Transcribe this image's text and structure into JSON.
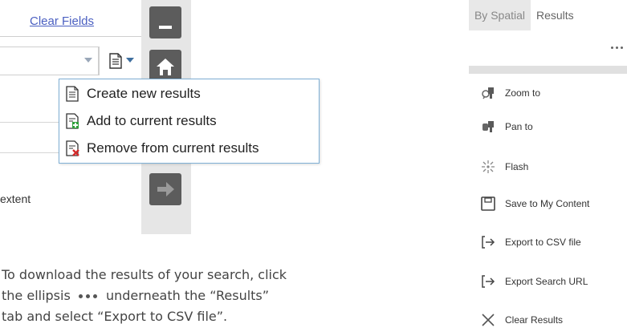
{
  "left_ui": {
    "clear_fields": "Clear Fields",
    "extent_text": "extent",
    "dropdown_items": [
      {
        "label": "Create new results",
        "icon": "document-icon"
      },
      {
        "label": "Add to current results",
        "icon": "add-document-icon"
      },
      {
        "label": "Remove from current results",
        "icon": "remove-document-icon"
      }
    ]
  },
  "caption": {
    "part1": "To download the results of your search, click the ellipsis",
    "part2": "underneath the “Results” tab and select “Export to CSV file”."
  },
  "right_panel": {
    "tabs": [
      "By Spatial",
      "Results"
    ],
    "menu_items": [
      {
        "label": "Zoom to",
        "icon": "zoom-to-icon"
      },
      {
        "label": "Pan to",
        "icon": "pan-to-icon"
      },
      {
        "label": "Flash",
        "icon": "flash-icon"
      },
      {
        "label": "Save to My Content",
        "icon": "save-icon"
      },
      {
        "label": "Export to CSV file",
        "icon": "export-icon"
      },
      {
        "label": "Export Search URL",
        "icon": "export-icon"
      },
      {
        "label": "Clear Results",
        "icon": "close-icon"
      }
    ]
  },
  "colors": {
    "link": "#4a5fc1",
    "dropdown_border": "#7fb0d6",
    "toolbar_button": "#5c5c5c",
    "add_green": "#2e9e3a",
    "remove_red": "#d42a2a"
  }
}
